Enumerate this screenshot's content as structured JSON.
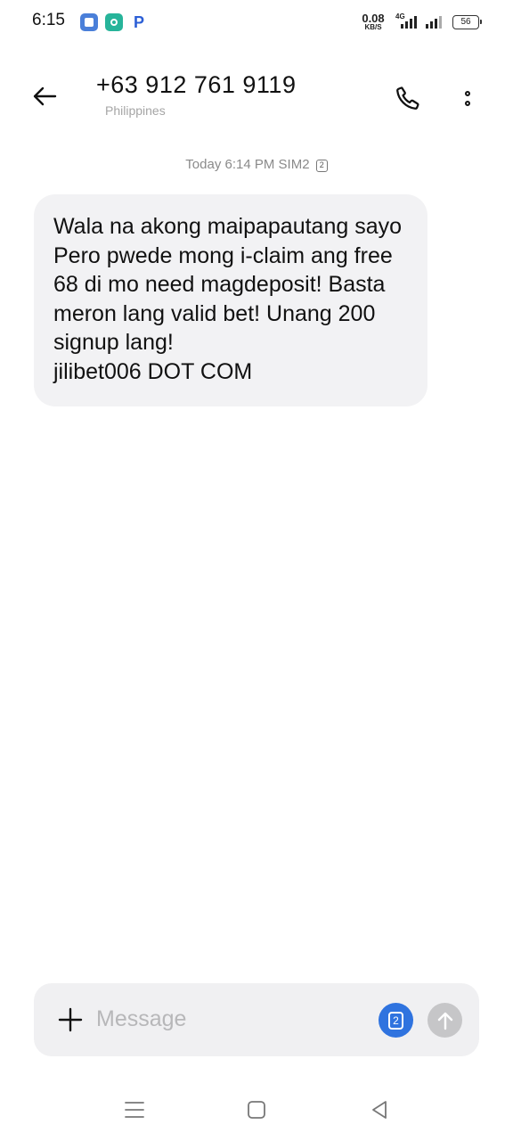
{
  "status_bar": {
    "time": "6:15",
    "app_icons": [
      "app-icon-blue",
      "app-icon-green",
      "p-app-icon"
    ],
    "net_speed_value": "0.08",
    "net_speed_unit": "KB/S",
    "network_type": "4G",
    "battery_level": "56"
  },
  "header": {
    "contact_number": "+63 912 761 9119",
    "contact_region": "Philippines",
    "back_icon": "arrow-left-icon",
    "call_icon": "phone-icon",
    "more_icon": "more-vertical-icon"
  },
  "conversation": {
    "meta": "Today 6:14 PM SIM2",
    "sim_slot": "2",
    "messages": [
      {
        "direction": "incoming",
        "text": "Wala na akong maipapautang sayo\nPero pwede mong i-claim ang free\n68 di mo need magdeposit! Basta\nmeron lang valid bet! Unang 200\nsignup lang!\njilibet006 DOT COM"
      }
    ]
  },
  "composer": {
    "placeholder": "Message",
    "value": "",
    "sim_slot": "2",
    "add_icon": "plus-icon",
    "send_icon": "send-arrow-up-icon"
  },
  "nav_bar": {
    "buttons": [
      "menu-icon",
      "home-square-icon",
      "back-triangle-icon"
    ]
  },
  "colors": {
    "bubble_bg": "#f2f2f4",
    "composer_bg": "#f0f0f2",
    "sim_button": "#2f73df",
    "send_button_disabled": "#c6c6c8",
    "meta_text": "#8a8a8a"
  }
}
